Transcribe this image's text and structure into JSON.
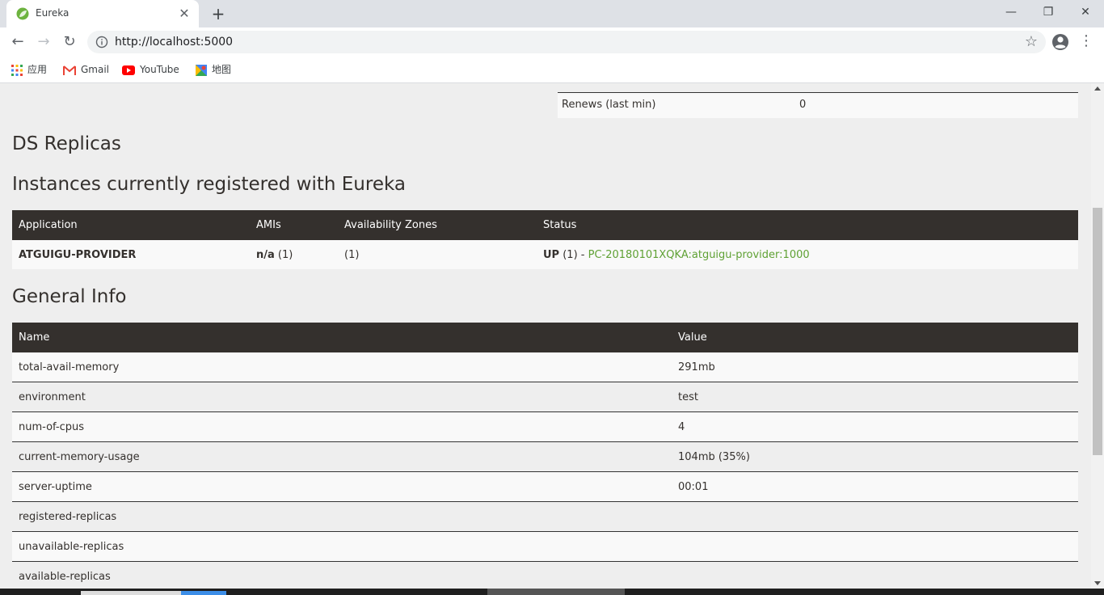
{
  "browser": {
    "tab_title": "Eureka",
    "tab_close": "✕",
    "new_tab": "+",
    "url": "http://localhost:5000",
    "bookmarks": [
      {
        "label": "应用",
        "icon": "apps-grid-icon"
      },
      {
        "label": "Gmail",
        "icon": "gmail-icon"
      },
      {
        "label": "YouTube",
        "icon": "youtube-icon"
      },
      {
        "label": "地图",
        "icon": "maps-icon"
      }
    ]
  },
  "page": {
    "renews_label": "Renews (last min)",
    "renews_value": "0",
    "ds_replicas_heading": "DS Replicas",
    "instances_heading": "Instances currently registered with Eureka",
    "instances_table": {
      "headers": [
        "Application",
        "AMIs",
        "Availability Zones",
        "Status"
      ],
      "rows": [
        {
          "application": "ATGUIGU-PROVIDER",
          "amis_bold": "n/a",
          "amis_count": "(1)",
          "zones": "(1)",
          "status_bold": "UP",
          "status_count": "(1) -",
          "status_link": "PC-20180101XQKA:atguigu-provider:1000"
        }
      ]
    },
    "general_info_heading": "General Info",
    "general_table": {
      "headers": [
        "Name",
        "Value"
      ],
      "rows": [
        [
          "total-avail-memory",
          "291mb"
        ],
        [
          "environment",
          "test"
        ],
        [
          "num-of-cpus",
          "4"
        ],
        [
          "current-memory-usage",
          "104mb (35%)"
        ],
        [
          "server-uptime",
          "00:01"
        ],
        [
          "registered-replicas",
          ""
        ],
        [
          "unavailable-replicas",
          ""
        ],
        [
          "available-replicas",
          ""
        ]
      ]
    }
  },
  "colors": {
    "header_bg": "#34302d",
    "link": "#5fa134",
    "page_bg": "#eeeeee"
  }
}
